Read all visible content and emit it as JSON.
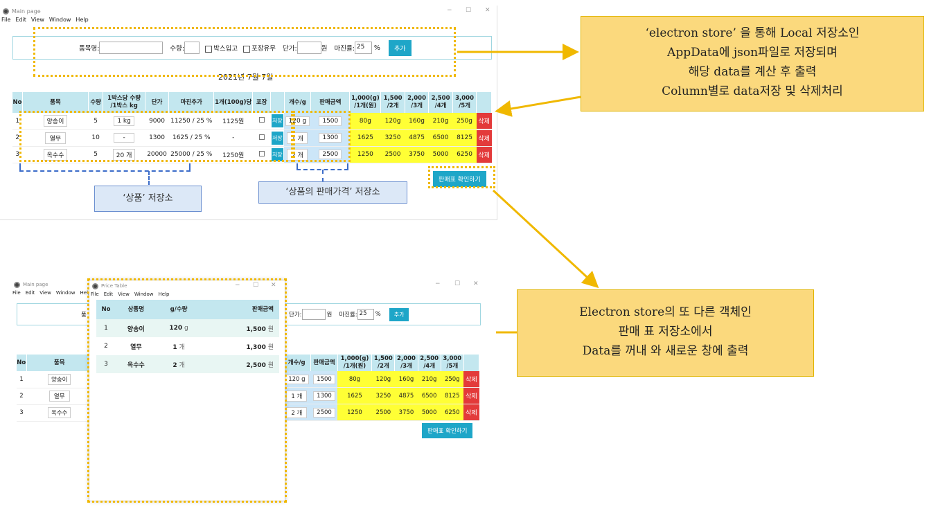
{
  "main": {
    "title": "Main page",
    "menu": [
      "File",
      "Edit",
      "View",
      "Window",
      "Help"
    ],
    "form": {
      "name_label": "품목명:",
      "qty_label": "수량:",
      "box_label": "박스입고",
      "pack_label": "포장유무",
      "price_label": "단가:",
      "won": "원",
      "margin_label": "마진률:",
      "margin_value": "25",
      "percent": "%",
      "add_button": "추가"
    },
    "date": "2021년 7월 7일",
    "headers": [
      "No",
      "품목",
      "수량",
      "1박스당 수량\n/1박스 kg",
      "단가",
      "마진추가",
      "1개(100g)당",
      "포장",
      "",
      "개수/g",
      "판매금액",
      "1,000(g)\n/1개(원)",
      "1,500\n/2개",
      "2,000\n/3개",
      "2,500\n/4개",
      "3,000\n/5개",
      ""
    ],
    "rows": [
      {
        "no": "1",
        "name": "양송이",
        "qty": "5",
        "box": "1 kg",
        "price": "9000",
        "margin": "11250 / 25 %",
        "unit": "1125원",
        "save": "저장",
        "count": "120 g",
        "sale": "1500",
        "p1": "80g",
        "p2": "120g",
        "p3": "160g",
        "p4": "210g",
        "p5": "250g",
        "del": "삭제"
      },
      {
        "no": "2",
        "name": "열무",
        "qty": "10",
        "box": "-",
        "price": "1300",
        "margin": "1625 / 25 %",
        "unit": "-",
        "save": "저장",
        "count": "1 개",
        "sale": "1300",
        "p1": "1625",
        "p2": "3250",
        "p3": "4875",
        "p4": "6500",
        "p5": "8125",
        "del": "삭제"
      },
      {
        "no": "3",
        "name": "옥수수",
        "qty": "5",
        "box": "20 개",
        "price": "20000",
        "margin": "25000 / 25 %",
        "unit": "1250원",
        "save": "저장",
        "count": "2 개",
        "sale": "2500",
        "p1": "1250",
        "p2": "2500",
        "p3": "3750",
        "p4": "5000",
        "p5": "6250",
        "del": "삭제"
      }
    ],
    "check_button": "판매표 확인하기"
  },
  "annotations": {
    "top_right": [
      "‘electron store’ 을 통해 Local 저장소인",
      "AppData에 json파일로 저장되며",
      "해당 data를 계산 후 출력",
      "Column별로 data저장 및 삭제처리"
    ],
    "bottom_right": [
      "Electron store의 또 다른 객체인",
      "판매 표 저장소에서",
      "Data를 꺼내 와 새로운 창에 출력"
    ],
    "product_store": "‘상품’ 저장소",
    "sale_price_store": "‘상품의 판매가격’ 저장소"
  },
  "second": {
    "main_title": "Main page",
    "menu": [
      "File",
      "Edit",
      "View",
      "Window",
      "Help"
    ],
    "form_partial": {
      "price_label": "단가:",
      "won": "원",
      "margin_label": "마진률:",
      "margin_value": "25",
      "percent": "%",
      "add_button": "추가",
      "name_fragment": "품"
    },
    "headers_left": [
      "No",
      "품목"
    ],
    "headers_right": [
      "개수/g",
      "판매금액",
      "1,000(g)\n/1개(원)",
      "1,500\n/2개",
      "2,000\n/3개",
      "2,500\n/4개",
      "3,000\n/5개"
    ],
    "rows": [
      {
        "no": "1",
        "name": "양송이",
        "count": "120 g",
        "sale": "1500",
        "p1": "80g",
        "p2": "120g",
        "p3": "160g",
        "p4": "210g",
        "p5": "250g",
        "del": "삭제"
      },
      {
        "no": "2",
        "name": "열무",
        "count": "1 개",
        "sale": "1300",
        "p1": "1625",
        "p2": "3250",
        "p3": "4875",
        "p4": "6500",
        "p5": "8125",
        "del": "삭제"
      },
      {
        "no": "3",
        "name": "옥수수",
        "count": "2 개",
        "sale": "2500",
        "p1": "1250",
        "p2": "2500",
        "p3": "3750",
        "p4": "5000",
        "p5": "6250",
        "del": "삭제"
      }
    ],
    "check_button": "판매표 확인하기"
  },
  "price_table": {
    "title": "Price Table",
    "menu": [
      "File",
      "Edit",
      "View",
      "Window",
      "Help"
    ],
    "headers": [
      "No",
      "상품명",
      "g/수량",
      "판매금액"
    ],
    "rows": [
      {
        "no": "1",
        "name": "양송이",
        "qty": "120",
        "unit": "g",
        "amount": "1,500",
        "won": "원"
      },
      {
        "no": "2",
        "name": "열무",
        "qty": "1",
        "unit": "개",
        "amount": "1,300",
        "won": "원"
      },
      {
        "no": "3",
        "name": "옥수수",
        "qty": "2",
        "unit": "개",
        "amount": "2,500",
        "won": "원"
      }
    ]
  },
  "colors": {
    "accent": "#1ea6c8",
    "header_bg": "#c3e7ef",
    "yellow": "#ffff35",
    "delete": "#e33a3a",
    "annotation_bg": "#fbd97d",
    "dotted": "#f0b800",
    "dashed": "#3b6cc9",
    "arrow": "#f0b800"
  }
}
